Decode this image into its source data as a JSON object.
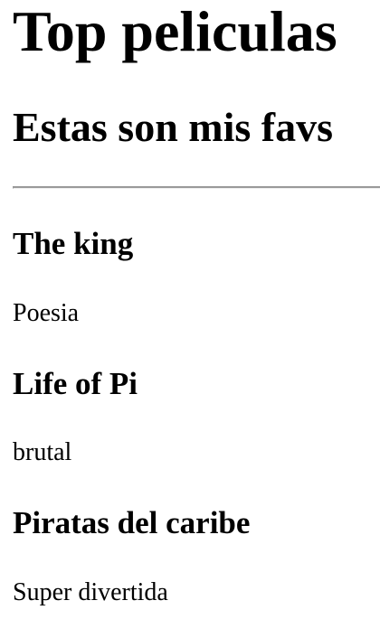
{
  "header": {
    "title": "Top peliculas",
    "subtitle": "Estas son mis favs"
  },
  "movies": [
    {
      "title": "The king",
      "description": "Poesia"
    },
    {
      "title": "Life of Pi",
      "description": "brutal"
    },
    {
      "title": "Piratas del caribe",
      "description": "Super divertida"
    }
  ]
}
